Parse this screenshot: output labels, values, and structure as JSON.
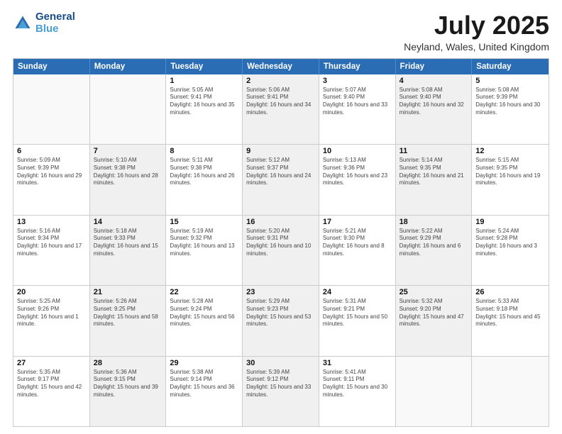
{
  "logo": {
    "line1": "General",
    "line2": "Blue"
  },
  "title": "July 2025",
  "subtitle": "Neyland, Wales, United Kingdom",
  "header_days": [
    "Sunday",
    "Monday",
    "Tuesday",
    "Wednesday",
    "Thursday",
    "Friday",
    "Saturday"
  ],
  "weeks": [
    [
      {
        "day": "",
        "sunrise": "",
        "sunset": "",
        "daylight": "",
        "shaded": false,
        "empty": true
      },
      {
        "day": "",
        "sunrise": "",
        "sunset": "",
        "daylight": "",
        "shaded": false,
        "empty": true
      },
      {
        "day": "1",
        "sunrise": "Sunrise: 5:05 AM",
        "sunset": "Sunset: 9:41 PM",
        "daylight": "Daylight: 16 hours and 35 minutes.",
        "shaded": false,
        "empty": false
      },
      {
        "day": "2",
        "sunrise": "Sunrise: 5:06 AM",
        "sunset": "Sunset: 9:41 PM",
        "daylight": "Daylight: 16 hours and 34 minutes.",
        "shaded": true,
        "empty": false
      },
      {
        "day": "3",
        "sunrise": "Sunrise: 5:07 AM",
        "sunset": "Sunset: 9:40 PM",
        "daylight": "Daylight: 16 hours and 33 minutes.",
        "shaded": false,
        "empty": false
      },
      {
        "day": "4",
        "sunrise": "Sunrise: 5:08 AM",
        "sunset": "Sunset: 9:40 PM",
        "daylight": "Daylight: 16 hours and 32 minutes.",
        "shaded": true,
        "empty": false
      },
      {
        "day": "5",
        "sunrise": "Sunrise: 5:08 AM",
        "sunset": "Sunset: 9:39 PM",
        "daylight": "Daylight: 16 hours and 30 minutes.",
        "shaded": false,
        "empty": false
      }
    ],
    [
      {
        "day": "6",
        "sunrise": "Sunrise: 5:09 AM",
        "sunset": "Sunset: 9:39 PM",
        "daylight": "Daylight: 16 hours and 29 minutes.",
        "shaded": false,
        "empty": false
      },
      {
        "day": "7",
        "sunrise": "Sunrise: 5:10 AM",
        "sunset": "Sunset: 9:38 PM",
        "daylight": "Daylight: 16 hours and 28 minutes.",
        "shaded": true,
        "empty": false
      },
      {
        "day": "8",
        "sunrise": "Sunrise: 5:11 AM",
        "sunset": "Sunset: 9:38 PM",
        "daylight": "Daylight: 16 hours and 26 minutes.",
        "shaded": false,
        "empty": false
      },
      {
        "day": "9",
        "sunrise": "Sunrise: 5:12 AM",
        "sunset": "Sunset: 9:37 PM",
        "daylight": "Daylight: 16 hours and 24 minutes.",
        "shaded": true,
        "empty": false
      },
      {
        "day": "10",
        "sunrise": "Sunrise: 5:13 AM",
        "sunset": "Sunset: 9:36 PM",
        "daylight": "Daylight: 16 hours and 23 minutes.",
        "shaded": false,
        "empty": false
      },
      {
        "day": "11",
        "sunrise": "Sunrise: 5:14 AM",
        "sunset": "Sunset: 9:35 PM",
        "daylight": "Daylight: 16 hours and 21 minutes.",
        "shaded": true,
        "empty": false
      },
      {
        "day": "12",
        "sunrise": "Sunrise: 5:15 AM",
        "sunset": "Sunset: 9:35 PM",
        "daylight": "Daylight: 16 hours and 19 minutes.",
        "shaded": false,
        "empty": false
      }
    ],
    [
      {
        "day": "13",
        "sunrise": "Sunrise: 5:16 AM",
        "sunset": "Sunset: 9:34 PM",
        "daylight": "Daylight: 16 hours and 17 minutes.",
        "shaded": false,
        "empty": false
      },
      {
        "day": "14",
        "sunrise": "Sunrise: 5:18 AM",
        "sunset": "Sunset: 9:33 PM",
        "daylight": "Daylight: 16 hours and 15 minutes.",
        "shaded": true,
        "empty": false
      },
      {
        "day": "15",
        "sunrise": "Sunrise: 5:19 AM",
        "sunset": "Sunset: 9:32 PM",
        "daylight": "Daylight: 16 hours and 13 minutes.",
        "shaded": false,
        "empty": false
      },
      {
        "day": "16",
        "sunrise": "Sunrise: 5:20 AM",
        "sunset": "Sunset: 9:31 PM",
        "daylight": "Daylight: 16 hours and 10 minutes.",
        "shaded": true,
        "empty": false
      },
      {
        "day": "17",
        "sunrise": "Sunrise: 5:21 AM",
        "sunset": "Sunset: 9:30 PM",
        "daylight": "Daylight: 16 hours and 8 minutes.",
        "shaded": false,
        "empty": false
      },
      {
        "day": "18",
        "sunrise": "Sunrise: 5:22 AM",
        "sunset": "Sunset: 9:29 PM",
        "daylight": "Daylight: 16 hours and 6 minutes.",
        "shaded": true,
        "empty": false
      },
      {
        "day": "19",
        "sunrise": "Sunrise: 5:24 AM",
        "sunset": "Sunset: 9:28 PM",
        "daylight": "Daylight: 16 hours and 3 minutes.",
        "shaded": false,
        "empty": false
      }
    ],
    [
      {
        "day": "20",
        "sunrise": "Sunrise: 5:25 AM",
        "sunset": "Sunset: 9:26 PM",
        "daylight": "Daylight: 16 hours and 1 minute.",
        "shaded": false,
        "empty": false
      },
      {
        "day": "21",
        "sunrise": "Sunrise: 5:26 AM",
        "sunset": "Sunset: 9:25 PM",
        "daylight": "Daylight: 15 hours and 58 minutes.",
        "shaded": true,
        "empty": false
      },
      {
        "day": "22",
        "sunrise": "Sunrise: 5:28 AM",
        "sunset": "Sunset: 9:24 PM",
        "daylight": "Daylight: 15 hours and 56 minutes.",
        "shaded": false,
        "empty": false
      },
      {
        "day": "23",
        "sunrise": "Sunrise: 5:29 AM",
        "sunset": "Sunset: 9:23 PM",
        "daylight": "Daylight: 15 hours and 53 minutes.",
        "shaded": true,
        "empty": false
      },
      {
        "day": "24",
        "sunrise": "Sunrise: 5:31 AM",
        "sunset": "Sunset: 9:21 PM",
        "daylight": "Daylight: 15 hours and 50 minutes.",
        "shaded": false,
        "empty": false
      },
      {
        "day": "25",
        "sunrise": "Sunrise: 5:32 AM",
        "sunset": "Sunset: 9:20 PM",
        "daylight": "Daylight: 15 hours and 47 minutes.",
        "shaded": true,
        "empty": false
      },
      {
        "day": "26",
        "sunrise": "Sunrise: 5:33 AM",
        "sunset": "Sunset: 9:18 PM",
        "daylight": "Daylight: 15 hours and 45 minutes.",
        "shaded": false,
        "empty": false
      }
    ],
    [
      {
        "day": "27",
        "sunrise": "Sunrise: 5:35 AM",
        "sunset": "Sunset: 9:17 PM",
        "daylight": "Daylight: 15 hours and 42 minutes.",
        "shaded": false,
        "empty": false
      },
      {
        "day": "28",
        "sunrise": "Sunrise: 5:36 AM",
        "sunset": "Sunset: 9:15 PM",
        "daylight": "Daylight: 15 hours and 39 minutes.",
        "shaded": true,
        "empty": false
      },
      {
        "day": "29",
        "sunrise": "Sunrise: 5:38 AM",
        "sunset": "Sunset: 9:14 PM",
        "daylight": "Daylight: 15 hours and 36 minutes.",
        "shaded": false,
        "empty": false
      },
      {
        "day": "30",
        "sunrise": "Sunrise: 5:39 AM",
        "sunset": "Sunset: 9:12 PM",
        "daylight": "Daylight: 15 hours and 33 minutes.",
        "shaded": true,
        "empty": false
      },
      {
        "day": "31",
        "sunrise": "Sunrise: 5:41 AM",
        "sunset": "Sunset: 9:11 PM",
        "daylight": "Daylight: 15 hours and 30 minutes.",
        "shaded": false,
        "empty": false
      },
      {
        "day": "",
        "sunrise": "",
        "sunset": "",
        "daylight": "",
        "shaded": false,
        "empty": true
      },
      {
        "day": "",
        "sunrise": "",
        "sunset": "",
        "daylight": "",
        "shaded": false,
        "empty": true
      }
    ]
  ]
}
